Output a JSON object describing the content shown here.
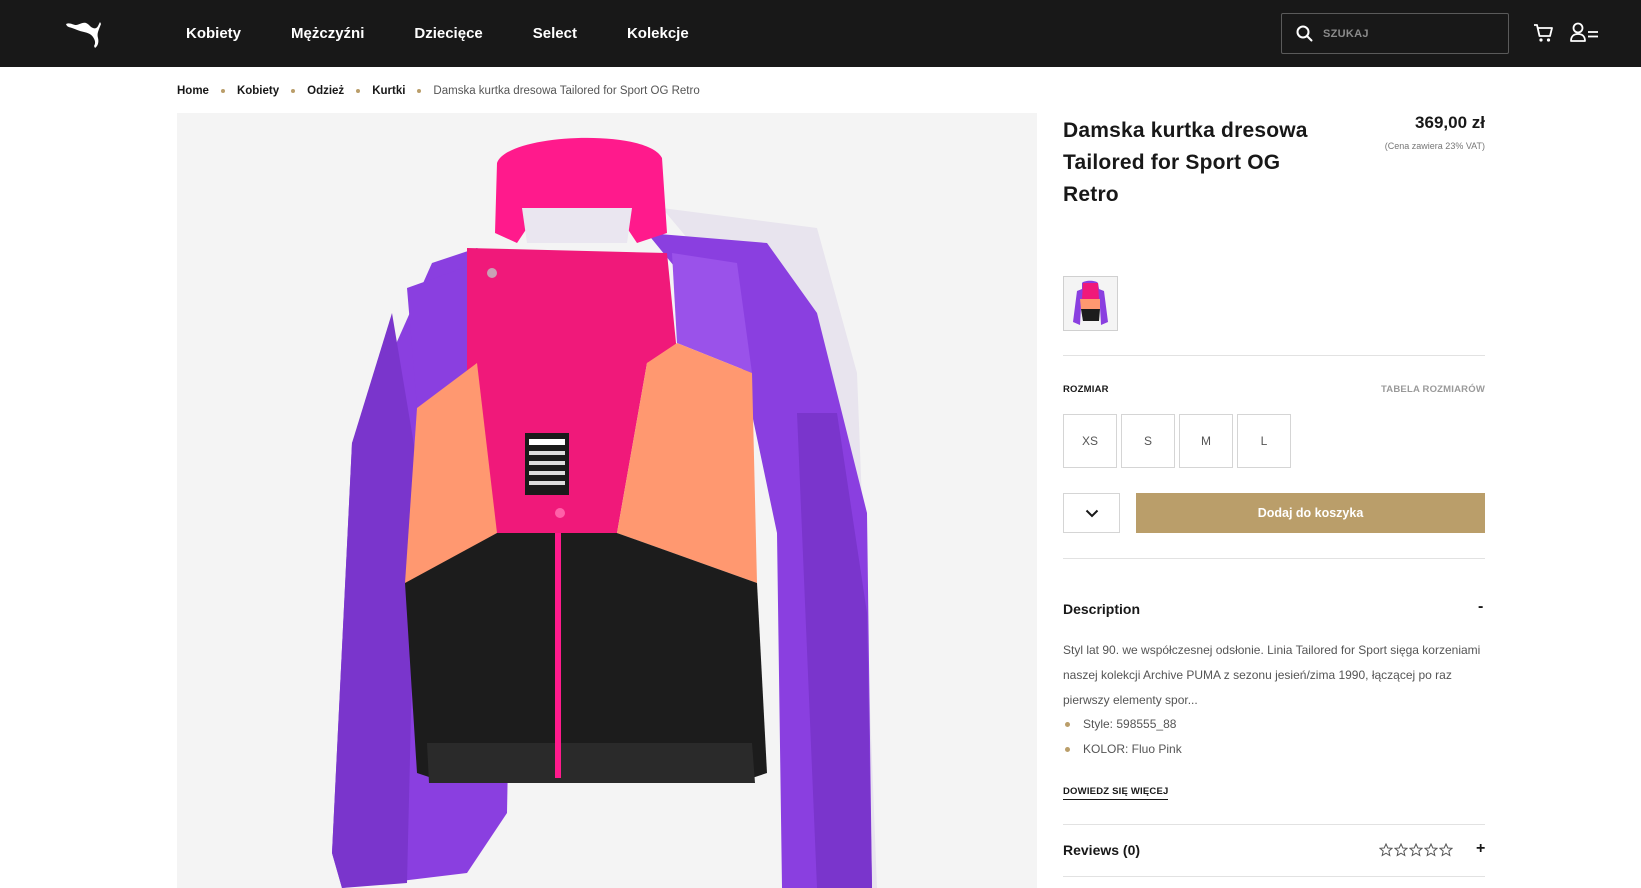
{
  "header": {
    "nav": [
      "Kobiety",
      "Mężczyźni",
      "Dziecięce",
      "Select",
      "Kolekcje"
    ],
    "search_placeholder": "SZUKAJ",
    "logo": "puma-cat-logo",
    "icons": [
      "search-icon",
      "cart-icon",
      "account-menu-icon"
    ]
  },
  "breadcrumb": {
    "items": [
      "Home",
      "Kobiety",
      "Odzież",
      "Kurtki"
    ],
    "current": "Damska kurtka dresowa Tailored for Sport OG Retro"
  },
  "product": {
    "title": "Damska kurtka dresowa Tailored for Sport OG Retro",
    "price": "369,00 zł",
    "vat_note": "(Cena zawiera 23% VAT)",
    "size_label": "ROZMIAR",
    "size_table_label": "TABELA ROZMIARÓW",
    "sizes": [
      "XS",
      "S",
      "M",
      "L"
    ],
    "add_to_cart": "Dodaj do koszyka",
    "description": {
      "heading": "Description",
      "toggle": "-",
      "text": "Styl lat 90. we współczesnej odsłonie. Linia Tailored for Sport sięga korzeniami naszej kolekcji Archive PUMA z sezonu jesień/zima 1990, łączącej po raz pierwszy elementy spor...",
      "bullets": [
        "Style: 598555_88",
        "KOLOR: Fluo Pink"
      ],
      "more_link": "DOWIEDZ SIĘ WIĘCEJ"
    },
    "reviews": {
      "heading": "Reviews (0)",
      "toggle": "+",
      "rating": 0,
      "max_rating": 5
    }
  },
  "colors": {
    "header_bg": "#181818",
    "accent_gold": "#ba9e6a",
    "jacket_pink": "#f0197a",
    "jacket_purple": "#8a3fe0",
    "jacket_peach": "#ff9870",
    "jacket_black": "#1c1c1c"
  }
}
